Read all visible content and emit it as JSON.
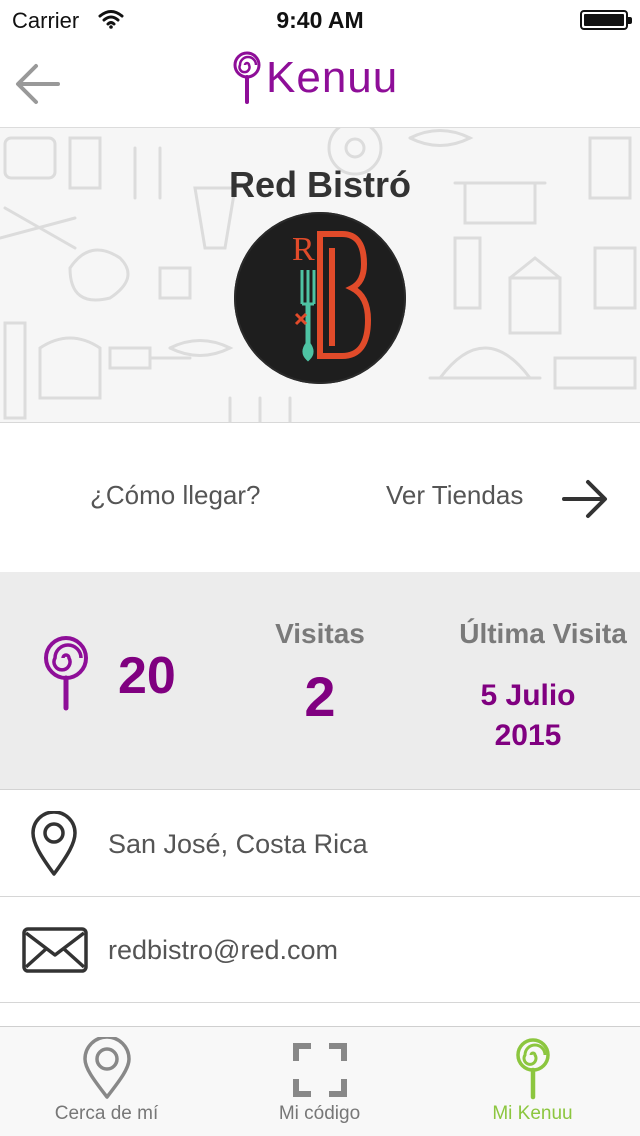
{
  "status_bar": {
    "carrier": "Carrier",
    "time": "9:40 AM"
  },
  "nav": {
    "brand": "Kenuu",
    "back_icon": "arrow-left-icon"
  },
  "venue": {
    "name": "Red Bistró",
    "logo_letters": "RB"
  },
  "actions": {
    "directions": "¿Cómo llegar?",
    "stores": "Ver Tiendas"
  },
  "stats": {
    "points": "20",
    "visits_label": "Visitas",
    "visits_value": "2",
    "last_visit_label": "Última Visita",
    "last_visit_date": "5 Julio",
    "last_visit_year": "2015"
  },
  "contact": {
    "location": "San José, Costa Rica",
    "email": "redbistro@red.com"
  },
  "tabs": [
    {
      "label": "Cerca de mí",
      "icon": "map-pin-icon",
      "active": false
    },
    {
      "label": "Mi código",
      "icon": "scan-frame-icon",
      "active": false
    },
    {
      "label": "Mi Kenuu",
      "icon": "lollipop-icon",
      "active": true
    }
  ],
  "colors": {
    "brand": "#8e0e98",
    "accent_purple": "#800080",
    "active_tab": "#8cc63f"
  }
}
